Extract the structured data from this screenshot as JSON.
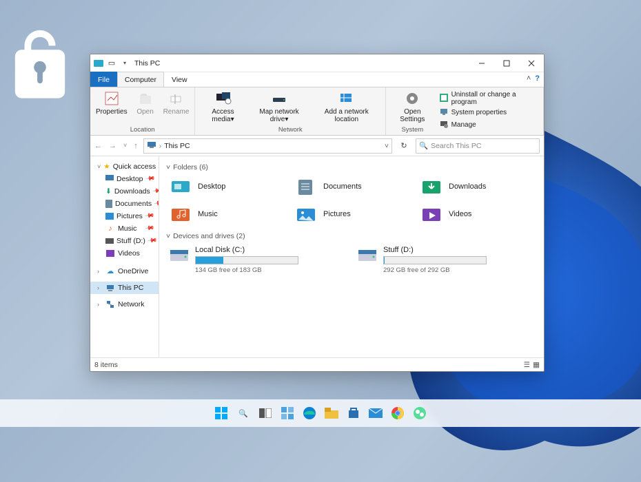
{
  "titlebar": {
    "title": "This PC"
  },
  "ribbon": {
    "tabs": {
      "file": "File",
      "computer": "Computer",
      "view": "View"
    },
    "location": {
      "properties": "Properties",
      "open": "Open",
      "rename": "Rename",
      "group_label": "Location"
    },
    "network": {
      "access_media": "Access media",
      "map_drive": "Map network drive",
      "add_location": "Add a network location",
      "group_label": "Network"
    },
    "system": {
      "open_settings": "Open Settings",
      "uninstall": "Uninstall or change a program",
      "sys_props": "System properties",
      "manage": "Manage",
      "group_label": "System"
    }
  },
  "nav": {
    "breadcrumb_root": "This PC",
    "search_placeholder": "Search This PC"
  },
  "sidebar": {
    "quick_access": "Quick access",
    "items": [
      {
        "label": "Desktop"
      },
      {
        "label": "Downloads"
      },
      {
        "label": "Documents"
      },
      {
        "label": "Pictures"
      },
      {
        "label": "Music"
      },
      {
        "label": "Stuff (D:)"
      },
      {
        "label": "Videos"
      }
    ],
    "onedrive": "OneDrive",
    "this_pc": "This PC",
    "network": "Network"
  },
  "content": {
    "folders_header": "Folders (6)",
    "drives_header": "Devices and drives (2)",
    "folders": [
      {
        "label": "Desktop",
        "color": "#2aa9c9"
      },
      {
        "label": "Documents",
        "color": "#6a8aa0"
      },
      {
        "label": "Downloads",
        "color": "#17a36b"
      },
      {
        "label": "Music",
        "color": "#e0622c"
      },
      {
        "label": "Pictures",
        "color": "#2a8dd6"
      },
      {
        "label": "Videos",
        "color": "#7a3fb6"
      }
    ],
    "drives": [
      {
        "label": "Local Disk (C:)",
        "free_text": "134 GB free of 183 GB",
        "fill_pct": 27,
        "fill_color": "#26a0da"
      },
      {
        "label": "Stuff (D:)",
        "free_text": "292 GB free of 292 GB",
        "fill_pct": 1,
        "fill_color": "#26a0da"
      }
    ]
  },
  "statusbar": {
    "items": "8 items"
  },
  "taskbar_icons": [
    "start-icon",
    "search-icon",
    "taskview-icon",
    "widgets-icon",
    "edge-icon",
    "explorer-icon",
    "store-icon",
    "mail-icon",
    "chrome-icon",
    "skype-icon"
  ]
}
